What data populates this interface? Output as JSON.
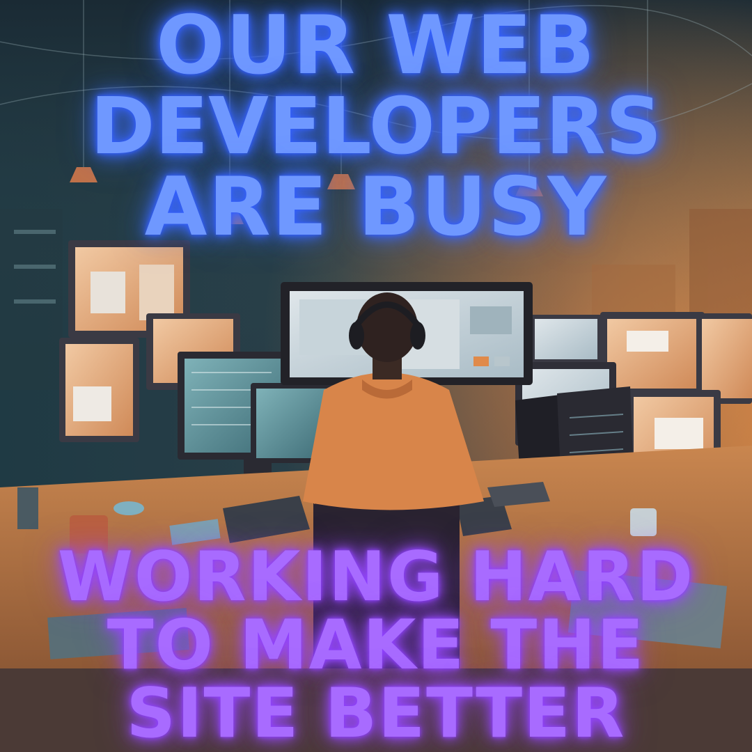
{
  "poster": {
    "headline_top": {
      "line1": "OUR WEB",
      "line2": "DEVELOPERS",
      "line3": "ARE BUSY"
    },
    "headline_bottom": {
      "line1": "WORKING HARD",
      "line2": "TO MAKE THE",
      "line3": "SITE BETTER"
    },
    "colors": {
      "top_text": "#6f98ff",
      "bottom_text": "#a86bff",
      "warm_accent": "#d9874a",
      "cool_accent": "#5fa0a8"
    }
  }
}
